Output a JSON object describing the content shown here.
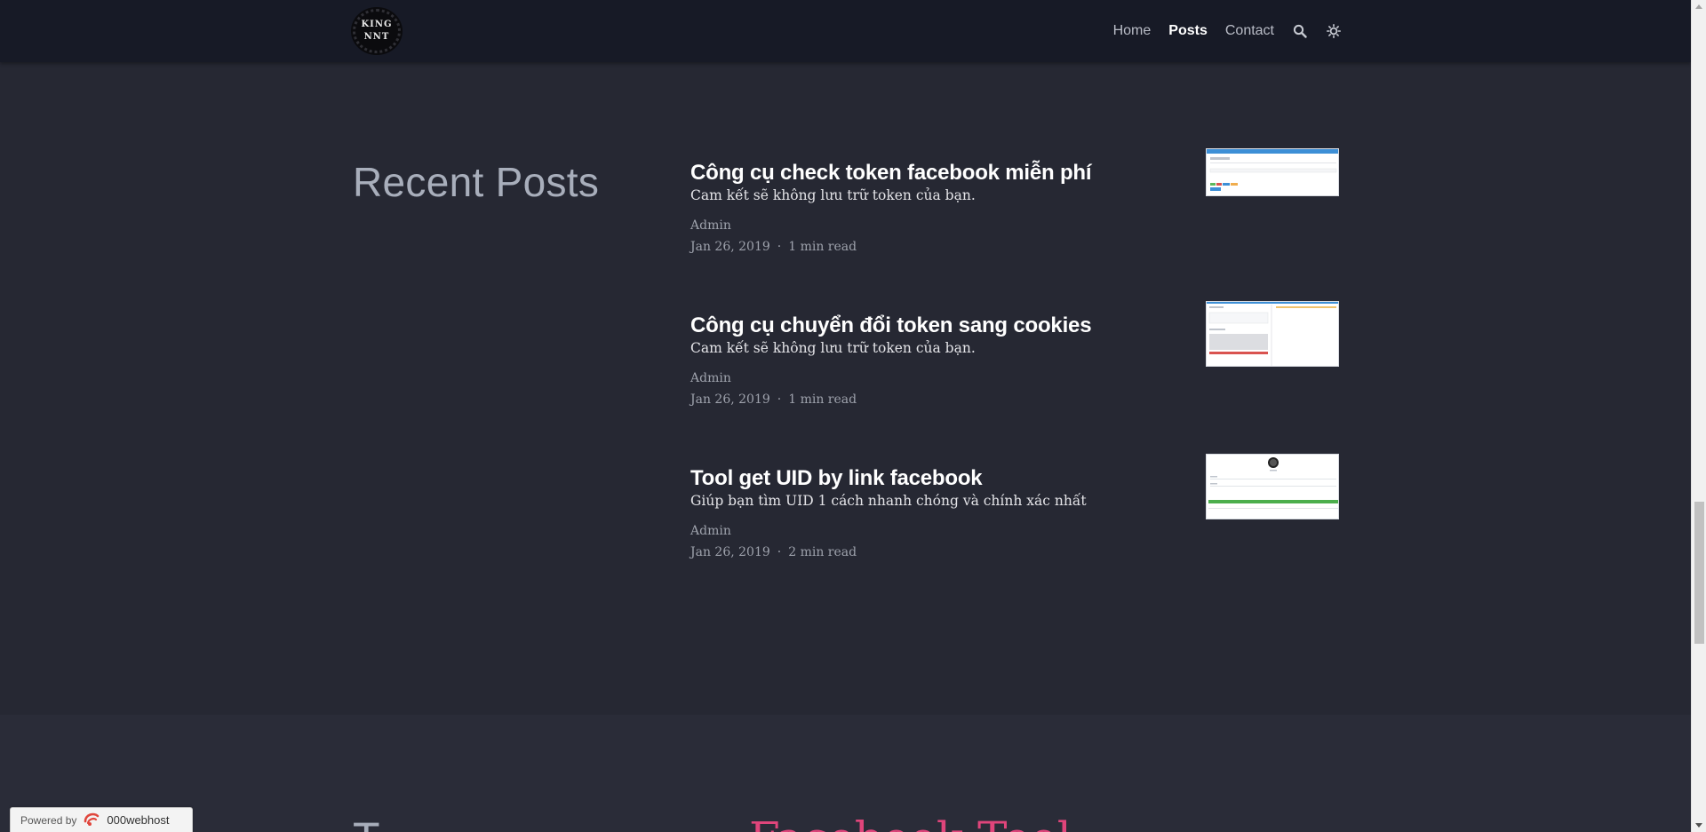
{
  "nav": {
    "logo_line1": "KING",
    "logo_line2": "NNT",
    "links": [
      "Home",
      "Posts",
      "Contact"
    ],
    "active": "Posts",
    "icons": [
      "search-icon",
      "theme-toggle-icon"
    ]
  },
  "recent": {
    "title": "Recent Posts",
    "posts": [
      {
        "title": "Công cụ check token facebook miễn phí",
        "excerpt": "Cam kết sẽ không lưu trữ token của bạn.",
        "author": "Admin",
        "date": "Jan 26, 2019",
        "read": "1 min read"
      },
      {
        "title": "Công cụ chuyển đổi token sang cookies",
        "excerpt": "Cam kết sẽ không lưu trữ token của bạn.",
        "author": "Admin",
        "date": "Jan 26, 2019",
        "read": "1 min read"
      },
      {
        "title": "Tool get UID by link facebook",
        "excerpt": "Giúp bạn tìm UID 1 cách nhanh chóng và chính xác nhất",
        "author": "Admin",
        "date": "Jan 26, 2019",
        "read": "2 min read"
      }
    ]
  },
  "lower": {
    "left_title": "T",
    "right_title": "Facebook Tool"
  },
  "badge": {
    "prefix": "Powered by",
    "brand": "000webhost"
  },
  "colors": {
    "page_bg": "#262833",
    "nav_bg": "#171a26",
    "accent_pink": "#e0457b"
  }
}
